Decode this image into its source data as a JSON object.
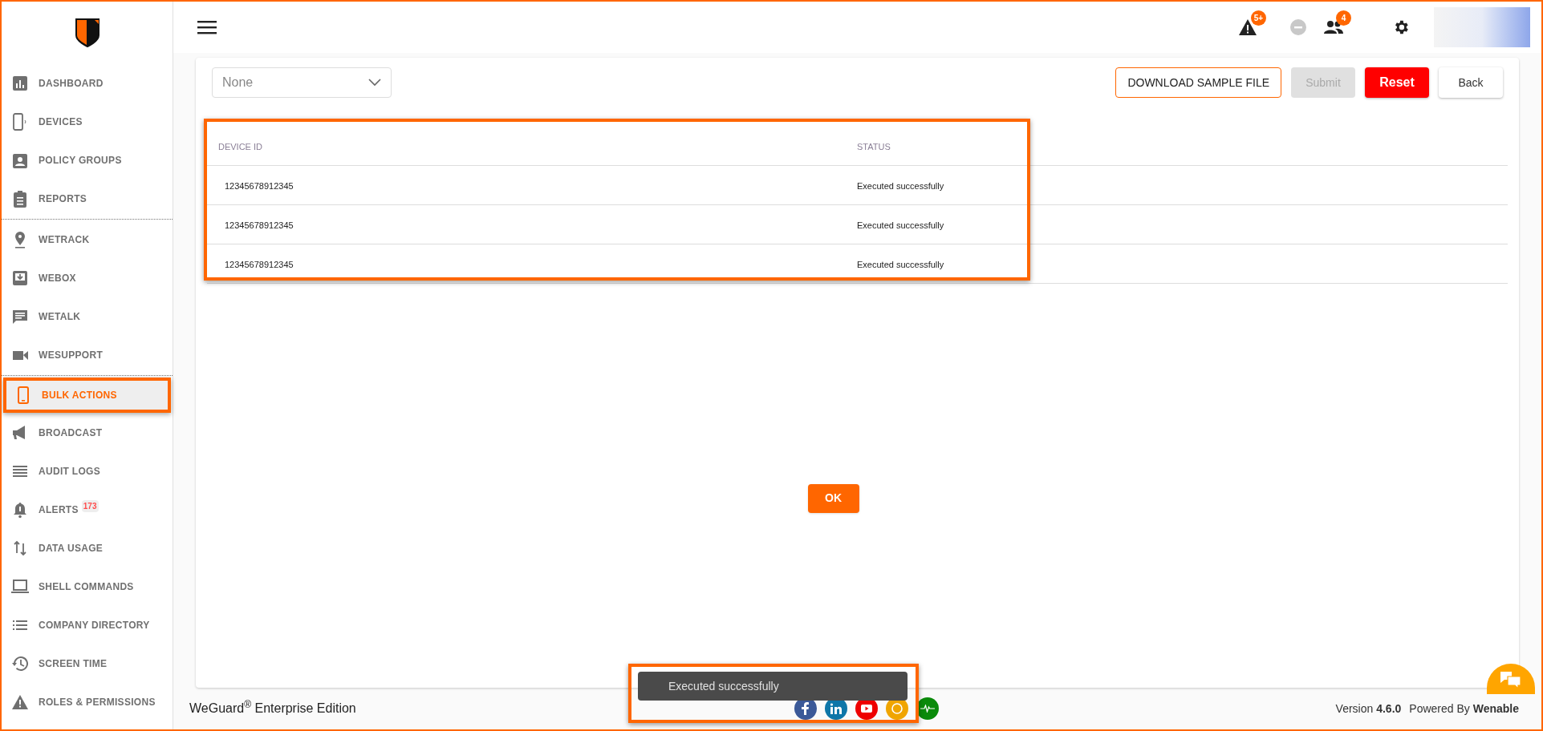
{
  "sidebar": {
    "items": [
      {
        "label": "DASHBOARD",
        "selected": false
      },
      {
        "label": "DEVICES",
        "selected": false
      },
      {
        "label": "POLICY GROUPS",
        "selected": false
      },
      {
        "label": "REPORTS",
        "selected": false,
        "divider_after": true
      },
      {
        "label": "WETRACK",
        "selected": false
      },
      {
        "label": "WEBOX",
        "selected": false
      },
      {
        "label": "WETALK",
        "selected": false
      },
      {
        "label": "WESUPPORT",
        "selected": false,
        "divider_after": true
      },
      {
        "label": "BULK ACTIONS",
        "selected": true
      },
      {
        "label": "BROADCAST",
        "selected": false
      },
      {
        "label": "AUDIT LOGS",
        "selected": false
      },
      {
        "label": "ALERTS",
        "selected": false,
        "badge": "173"
      },
      {
        "label": "DATA USAGE",
        "selected": false
      },
      {
        "label": "SHELL COMMANDS",
        "selected": false
      },
      {
        "label": "COMPANY DIRECTORY",
        "selected": false
      },
      {
        "label": "SCREEN TIME",
        "selected": false
      },
      {
        "label": "ROLES & PERMISSIONS",
        "selected": false
      }
    ]
  },
  "header": {
    "alerts_badge": "5+",
    "users_badge": "4"
  },
  "toolbar": {
    "select": {
      "value": "None"
    },
    "buttons": [
      {
        "label": "DOWNLOAD SAMPLE FILE",
        "kind": "outlined",
        "disabled": false
      },
      {
        "label": "Submit",
        "kind": "plain",
        "disabled": true
      },
      {
        "label": "Reset",
        "kind": "danger",
        "disabled": false
      },
      {
        "label": "Back",
        "kind": "plain",
        "disabled": false
      }
    ]
  },
  "table": {
    "columns": [
      "DEVICE ID",
      "STATUS"
    ],
    "rows": [
      [
        "12345678912345",
        "Executed successfully"
      ],
      [
        "12345678912345",
        "Executed successfully"
      ],
      [
        "12345678912345",
        "Executed successfully"
      ]
    ]
  },
  "ok_button": "OK",
  "toast": "Executed successfully",
  "footer": {
    "brand": "WeGuard$^{®}$ Enterprise Edition",
    "version_label": "Version",
    "version": "4.6.0",
    "powered_label": "Powered By",
    "powered_by": "Wenable"
  }
}
